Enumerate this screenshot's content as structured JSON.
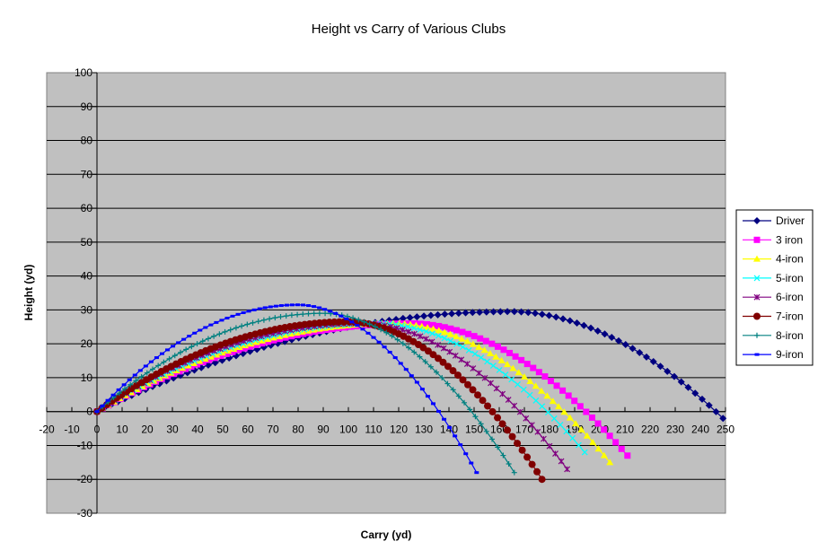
{
  "chart_data": {
    "type": "scatter",
    "title": "Height vs Carry of Various Clubs",
    "xlabel": "Carry (yd)",
    "ylabel": "Height (yd)",
    "xlim": [
      -20,
      250
    ],
    "ylim": [
      -30,
      100
    ],
    "x_ticks": [
      "-20",
      "-10",
      "0",
      "10",
      "20",
      "30",
      "40",
      "50",
      "60",
      "70",
      "80",
      "90",
      "100",
      "110",
      "120",
      "130",
      "140",
      "150",
      "160",
      "170",
      "180",
      "190",
      "200",
      "210",
      "220",
      "230",
      "240",
      "250"
    ],
    "y_ticks": [
      "-30",
      "-20",
      "-10",
      "0",
      "10",
      "20",
      "30",
      "40",
      "50",
      "60",
      "70",
      "80",
      "90",
      "100"
    ],
    "grid": "horizontal major",
    "legend_position": "right",
    "series": [
      {
        "name": "Driver",
        "color": "#000080",
        "marker": "diamond",
        "peak_x": 165,
        "peak_y": 29.5,
        "end_x": 249,
        "end_y": -2,
        "points": 90
      },
      {
        "name": "3 iron",
        "color": "#FF00FF",
        "marker": "square",
        "peak_x": 125,
        "peak_y": 26,
        "end_x": 211,
        "end_y": -13,
        "points": 90
      },
      {
        "name": "4-iron",
        "color": "#FFFF00",
        "marker": "triangle",
        "peak_x": 118,
        "peak_y": 26,
        "end_x": 204,
        "end_y": -15,
        "points": 90
      },
      {
        "name": "5-iron",
        "color": "#00FFFF",
        "marker": "x",
        "peak_x": 112,
        "peak_y": 26,
        "end_x": 194,
        "end_y": -12,
        "points": 80
      },
      {
        "name": "6-iron",
        "color": "#800080",
        "marker": "star",
        "peak_x": 106,
        "peak_y": 26,
        "end_x": 187,
        "end_y": -17,
        "points": 80
      },
      {
        "name": "7-iron",
        "color": "#800000",
        "marker": "circle",
        "peak_x": 100,
        "peak_y": 26.5,
        "end_x": 177,
        "end_y": -20,
        "points": 90
      },
      {
        "name": "8-iron",
        "color": "#008080",
        "marker": "plus",
        "peak_x": 90,
        "peak_y": 29,
        "end_x": 166,
        "end_y": -18,
        "points": 75
      },
      {
        "name": "9-iron",
        "color": "#0000FF",
        "marker": "dash",
        "peak_x": 80,
        "peak_y": 31.5,
        "end_x": 151,
        "end_y": -18,
        "points": 70
      }
    ]
  }
}
